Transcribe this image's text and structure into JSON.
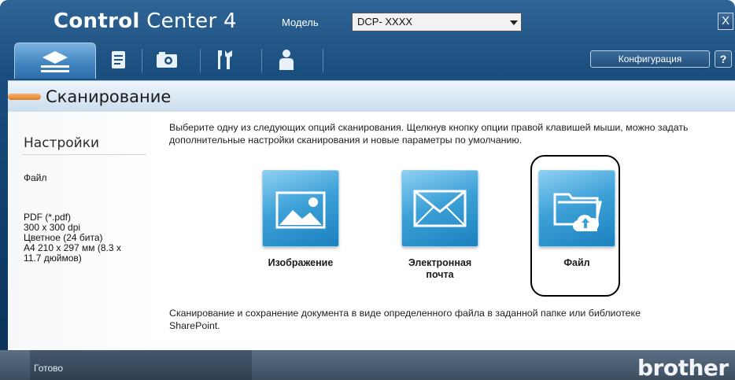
{
  "window": {
    "title_bold": "Control",
    "title_regular": " Center 4",
    "model_label": "Модель",
    "model_value": "DCP- XXXX",
    "close_label": "X"
  },
  "toolbar": {
    "tabs": [
      {
        "icon": "scan-icon",
        "active": true
      },
      {
        "icon": "document-icon",
        "active": false
      },
      {
        "icon": "photo-icon",
        "active": false
      },
      {
        "icon": "tools-icon",
        "active": false
      },
      {
        "icon": "user-icon",
        "active": false
      }
    ],
    "config_label": "Конфигурация",
    "help_label": "?"
  },
  "section": {
    "title": "Сканирование",
    "accent_color": "#e8842c"
  },
  "sidebar": {
    "heading": "Настройки",
    "file_type": "Файл",
    "settings_lines": [
      "PDF (*.pdf)",
      "300 x 300 dpi",
      "Цветное (24 бита)",
      "A4 210 x 297 мм (8.3 x",
      "11.7 дюймов)"
    ]
  },
  "main": {
    "instructions": "Выберите одну из следующих опций сканирования. Щелкнув кнопку опции правой клавишей мыши, можно задать дополнительные настройки сканирования и новые параметры по умолчанию.",
    "options": [
      {
        "label": "Изображение",
        "icon": "image-icon"
      },
      {
        "label": "Электронная почта",
        "icon": "envelope-icon"
      },
      {
        "label": "Файл",
        "icon": "folder-upload-icon",
        "highlighted": true
      }
    ],
    "selected_description": "Сканирование и сохранение документа в виде определенного файла в заданной папке или библиотеке SharePoint."
  },
  "status_bar": {
    "status_text": "Готово",
    "brand": "brother"
  }
}
